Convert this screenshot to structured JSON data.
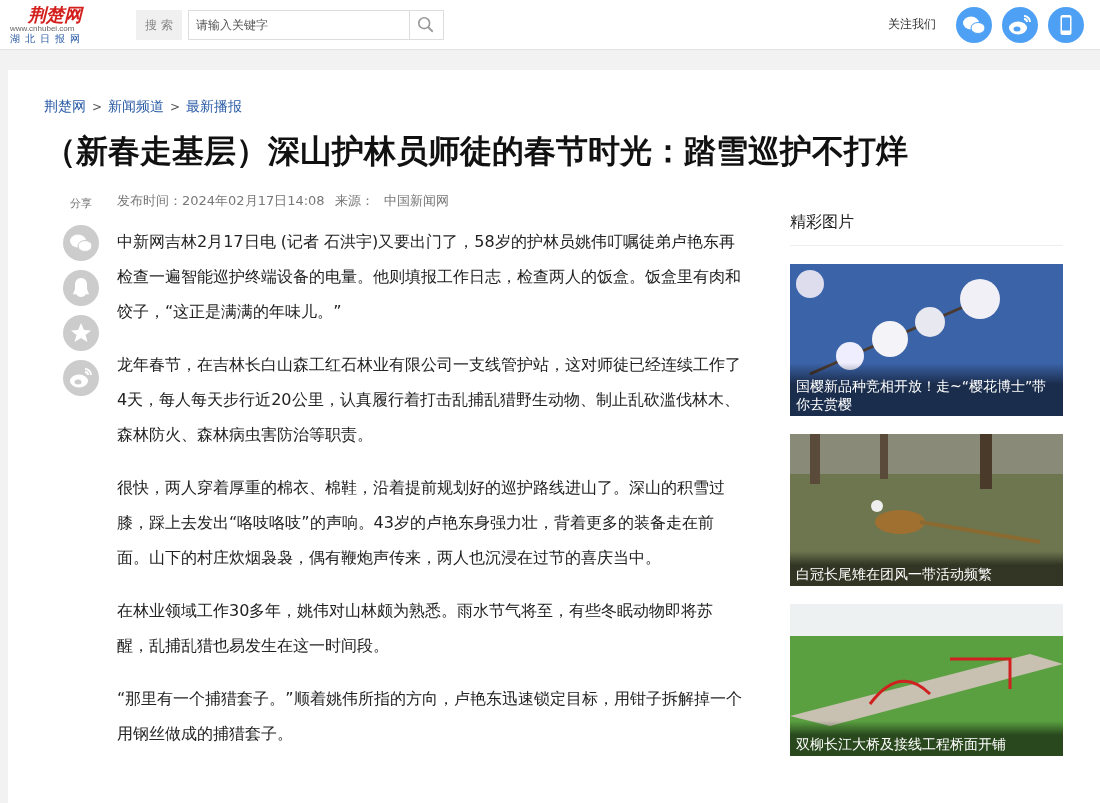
{
  "header": {
    "logo": {
      "name": "荆楚网",
      "url": "www.cnhubei.com",
      "sub": "湖北日报网"
    },
    "search": {
      "label": "搜 索",
      "placeholder": "请输入关键字"
    },
    "follow": {
      "label": "关注我们",
      "icons": [
        {
          "kind": "wechat"
        },
        {
          "kind": "weibo"
        },
        {
          "kind": "phone"
        }
      ]
    }
  },
  "breadcrumb": [
    {
      "label": "荆楚网"
    },
    {
      "label": "新闻频道"
    },
    {
      "label": "最新播报"
    }
  ],
  "breadcrumb_separator": ">",
  "article": {
    "title": "（新春走基层）深山护林员师徒的春节时光：踏雪巡护不打烊",
    "meta": {
      "published": "发布时间：2024年02月17日14:08",
      "source_label": "来源：",
      "source": "中国新闻网"
    },
    "share": {
      "label": "分享",
      "icons": [
        {
          "kind": "wechat"
        },
        {
          "kind": "qq"
        },
        {
          "kind": "star"
        },
        {
          "kind": "weibo"
        }
      ]
    },
    "paragraphs": [
      "中新网吉林2月17日电 (记者 石洪宇)又要出门了，58岁的护林员姚伟叮嘱徒弟卢艳东再检查一遍智能巡护终端设备的电量。他则填报工作日志，检查两人的饭盒。饭盒里有肉和饺子，“这正是满满的年味儿。”",
      "龙年春节，在吉林长白山森工红石林业有限公司一支线管护站，这对师徒已经连续工作了4天，每人每天步行近20公里，认真履行着打击乱捕乱猎野生动物、制止乱砍滥伐林木、森林防火、森林病虫害防治等职责。",
      "很快，两人穿着厚重的棉衣、棉鞋，沿着提前规划好的巡护路线进山了。深山的积雪过膝，踩上去发出“咯吱咯吱”的声响。43岁的卢艳东身强力壮，背着更多的装备走在前面。山下的村庄炊烟袅袅，偶有鞭炮声传来，两人也沉浸在过节的喜庆当中。",
      "在林业领域工作30多年，姚伟对山林颇为熟悉。雨水节气将至，有些冬眠动物即将苏醒，乱捕乱猎也易发生在这一时间段。",
      "“那里有一个捕猎套子。”顺着姚伟所指的方向，卢艳东迅速锁定目标，用钳子拆解掉一个用钢丝做成的捕猎套子。"
    ]
  },
  "sidebar": {
    "title": "精彩图片",
    "pictures": [
      {
        "kind": "blossom",
        "caption": "国樱新品种竞相开放！走~“樱花博士”带你去赏樱"
      },
      {
        "kind": "bird",
        "caption": "白冠长尾雉在团风一带活动频繁"
      },
      {
        "kind": "bridge",
        "caption": "双柳长江大桥及接线工程桥面开铺"
      }
    ]
  }
}
